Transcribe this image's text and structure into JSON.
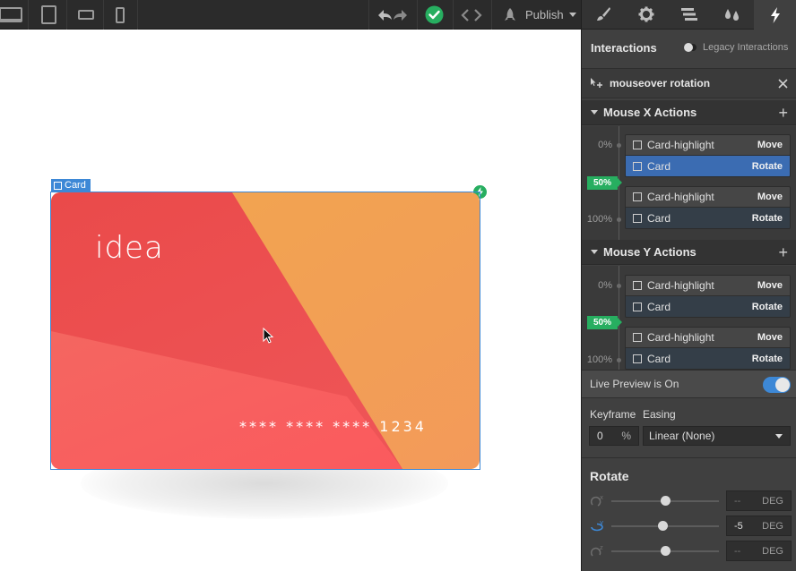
{
  "toolbar": {
    "devices": [
      "desktop-icon",
      "tablet-icon",
      "mobile-landscape-icon",
      "mobile-portrait-icon"
    ],
    "publish_label": "Publish"
  },
  "canvas": {
    "selection_label": "Card",
    "card": {
      "logo_text": "idea",
      "number_text": "**** **** **** 1234"
    }
  },
  "panel": {
    "tabs": [
      "brush-icon",
      "gear-icon",
      "navigator-icon",
      "drops-icon",
      "bolt-icon"
    ],
    "active_tab": "bolt-icon",
    "header": {
      "title": "Interactions",
      "legacy_label": "Legacy Interactions"
    },
    "interaction": {
      "name": "mouseover rotation"
    },
    "mouse_x": {
      "title": "Mouse X Actions",
      "keyframes": [
        {
          "pct": "0%",
          "actions": [
            {
              "name": "Card-highlight",
              "type": "Move"
            },
            {
              "name": "Card",
              "type": "Rotate"
            }
          ]
        },
        {
          "pct": "100%",
          "actions": [
            {
              "name": "Card-highlight",
              "type": "Move"
            },
            {
              "name": "Card",
              "type": "Rotate"
            }
          ]
        }
      ],
      "current_badge": "50%"
    },
    "mouse_y": {
      "title": "Mouse Y Actions",
      "keyframes": [
        {
          "pct": "0%",
          "actions": [
            {
              "name": "Card-highlight",
              "type": "Move"
            },
            {
              "name": "Card",
              "type": "Rotate"
            }
          ]
        },
        {
          "pct": "100%",
          "actions": [
            {
              "name": "Card-highlight",
              "type": "Move"
            },
            {
              "name": "Card",
              "type": "Rotate"
            }
          ]
        }
      ],
      "current_badge": "50%"
    },
    "live_preview_label": "Live Preview is On",
    "keyframe_label": "Keyframe",
    "keyframe_value": "0",
    "keyframe_unit": "%",
    "easing_label": "Easing",
    "easing_value": "Linear (None)",
    "rotate": {
      "title": "Rotate",
      "axes": [
        {
          "axis": "X",
          "value": "--",
          "unit": "DEG",
          "slider_fraction": 0.5
        },
        {
          "axis": "Y",
          "value": "-5",
          "unit": "DEG",
          "slider_fraction": 0.48
        },
        {
          "axis": "Z",
          "value": "--",
          "unit": "DEG",
          "slider_fraction": 0.5
        }
      ]
    }
  },
  "colors": {
    "accent_blue": "#3d88d6",
    "success_green": "#27ae60",
    "card_red": "#ee4d4c",
    "card_orange": "#f3a65b"
  }
}
